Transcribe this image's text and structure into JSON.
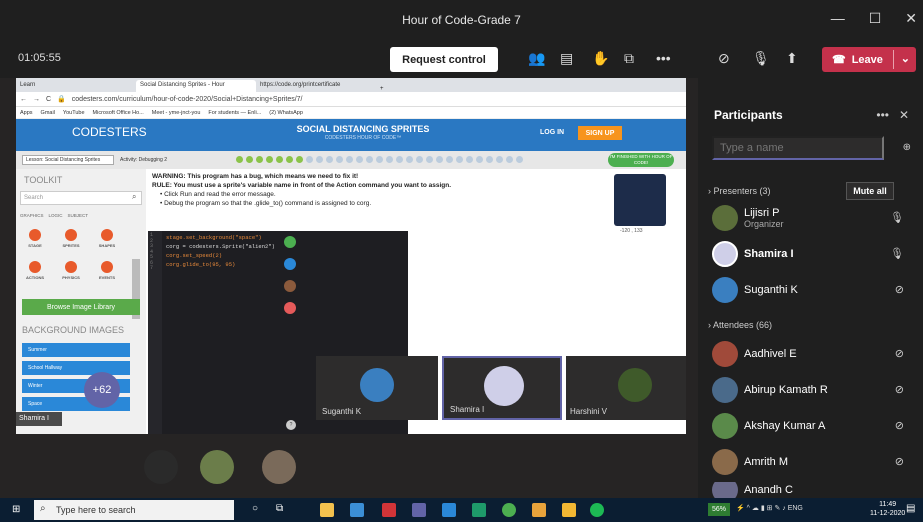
{
  "window": {
    "title": "Hour of Code-Grade 7",
    "controls": [
      "—",
      "☐",
      "✕"
    ]
  },
  "meeting": {
    "timer": "01:05:55",
    "request_control": "Request control",
    "leave": "Leave"
  },
  "browser": {
    "tabs": [
      "Learn",
      "Social Distancing Sprites - Hour",
      "https://code.org/printcertificate"
    ],
    "url": "codesters.com/curriculum/hour-of-code-2020/Social+Distancing+Sprites/7/",
    "bookmarks": [
      "Apps",
      "Gmail",
      "YouTube",
      "Microsoft Office Ho...",
      "Meet - yme-jnct-you",
      "For students — Enli...",
      "(2) WhatsApp"
    ]
  },
  "codesters": {
    "logo": "CODESTERS",
    "title": "SOCIAL DISTANCING SPRITES",
    "subtitle": "CODESTERS HOUR OF CODE™",
    "login": "LOG IN",
    "signup": "SIGN UP",
    "lesson": "Lesson: Social Distancing Sprites",
    "activity": "Activity: Debugging 2",
    "finished": "I'M FINISHED WITH HOUR OF CODE!",
    "toolkit": "TOOLKIT",
    "search": "Search",
    "tk_tabs": [
      "GRAPHICS",
      "LOGIC",
      "SUBJECT"
    ],
    "tk_icons": [
      "STAGE",
      "SPRITES",
      "SHAPES",
      "ACTIONS",
      "PHYSICS",
      "EVENTS"
    ],
    "browse": "Browse Image Library",
    "bg_title": "BACKGROUND IMAGES",
    "bg_items": [
      "Summer",
      "School Hallway",
      "Winter",
      "Space"
    ],
    "warning": "WARNING: This program has a bug, which means we need to fix it!",
    "rule": "RULE: You must use a sprite's variable name in front of the Action command you want to assign.",
    "step1": "Click Run and read the error message.",
    "step2": "Debug the program so that the .glide_to() command is assigned to corg.",
    "coords": "-120 , 133",
    "gutter": "1\n2\n3\n4\n5\n6\n7",
    "code": [
      "stage.set_background(\"space\")",
      "corg = codesters.Sprite(\"alien2\")",
      "corg.set_speed(2)",
      "corg.glide_to(95, 95)"
    ],
    "help": "?"
  },
  "speaker": "Shamira I",
  "tiles": {
    "more": "+62",
    "people": [
      "Suganthi K",
      "Shamira I",
      "Harshini V"
    ]
  },
  "participants": {
    "title": "Participants",
    "search_placeholder": "Type a name",
    "presenters_label": "Presenters (3)",
    "mute_all": "Mute all",
    "presenters": [
      {
        "name": "Lijisri P",
        "role": "Organizer"
      },
      {
        "name": "Shamira I",
        "role": ""
      },
      {
        "name": "Suganthi K",
        "role": ""
      }
    ],
    "attendees_label": "Attendees (66)",
    "attendees": [
      "Aadhivel E",
      "Abirup Kamath R",
      "Akshay Kumar A",
      "Amrith M",
      "Anandh C"
    ]
  },
  "taskbar": {
    "search": "Type here to search",
    "battery": "56%",
    "lang": "ENG",
    "time": "11:49",
    "date": "11-12-2020"
  },
  "colors": {
    "accent": "#6264a7",
    "leave": "#c4314b",
    "codesters_blue": "#2a78c2"
  }
}
